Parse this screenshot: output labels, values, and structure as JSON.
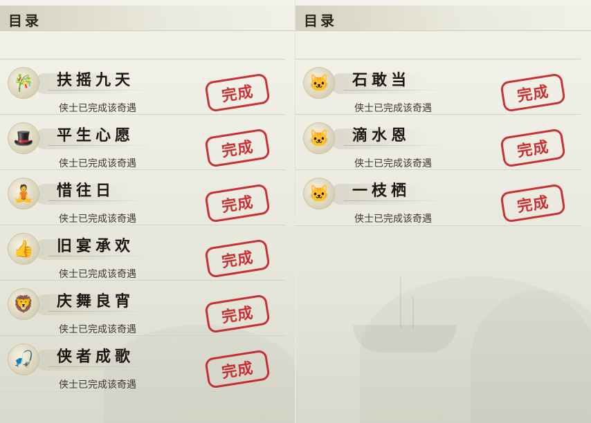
{
  "left_panel": {
    "title": "目录",
    "items": [
      {
        "name": "扶摇九天",
        "status": "侠士已完成该奇遇",
        "stamp": "完成",
        "icon": "bamboo-scroll-icon",
        "glyph": "🎋"
      },
      {
        "name": "平生心愿",
        "status": "侠士已完成该奇遇",
        "stamp": "完成",
        "icon": "official-portrait-icon",
        "glyph": "🎩"
      },
      {
        "name": "惜往日",
        "status": "侠士已完成该奇遇",
        "stamp": "完成",
        "icon": "golden-buddha-icon",
        "glyph": "🧘"
      },
      {
        "name": "旧宴承欢",
        "status": "侠士已完成该奇遇",
        "stamp": "完成",
        "icon": "thumbs-up-icon",
        "glyph": "👍"
      },
      {
        "name": "庆舞良宵",
        "status": "侠士已完成该奇遇",
        "stamp": "完成",
        "icon": "lion-dance-icon",
        "glyph": "🦁"
      },
      {
        "name": "侠者成歌",
        "status": "侠士已完成该奇遇",
        "stamp": "完成",
        "icon": "fishing-rod-icon",
        "glyph": "🎣"
      }
    ]
  },
  "right_panel": {
    "title": "目录",
    "items": [
      {
        "name": "石敢当",
        "status": "侠士已完成该奇遇",
        "stamp": "完成",
        "icon": "cat-portrait-icon",
        "glyph": "🐱"
      },
      {
        "name": "滴水恩",
        "status": "侠士已完成该奇遇",
        "stamp": "完成",
        "icon": "cat-portrait-icon",
        "glyph": "🐱"
      },
      {
        "name": "一枝栖",
        "status": "侠士已完成该奇遇",
        "stamp": "完成",
        "icon": "cat-portrait-icon",
        "glyph": "🐱"
      }
    ]
  },
  "colors": {
    "stamp_red": "#c3181c",
    "title_text": "#1c160d",
    "status_text": "#3c372c"
  }
}
